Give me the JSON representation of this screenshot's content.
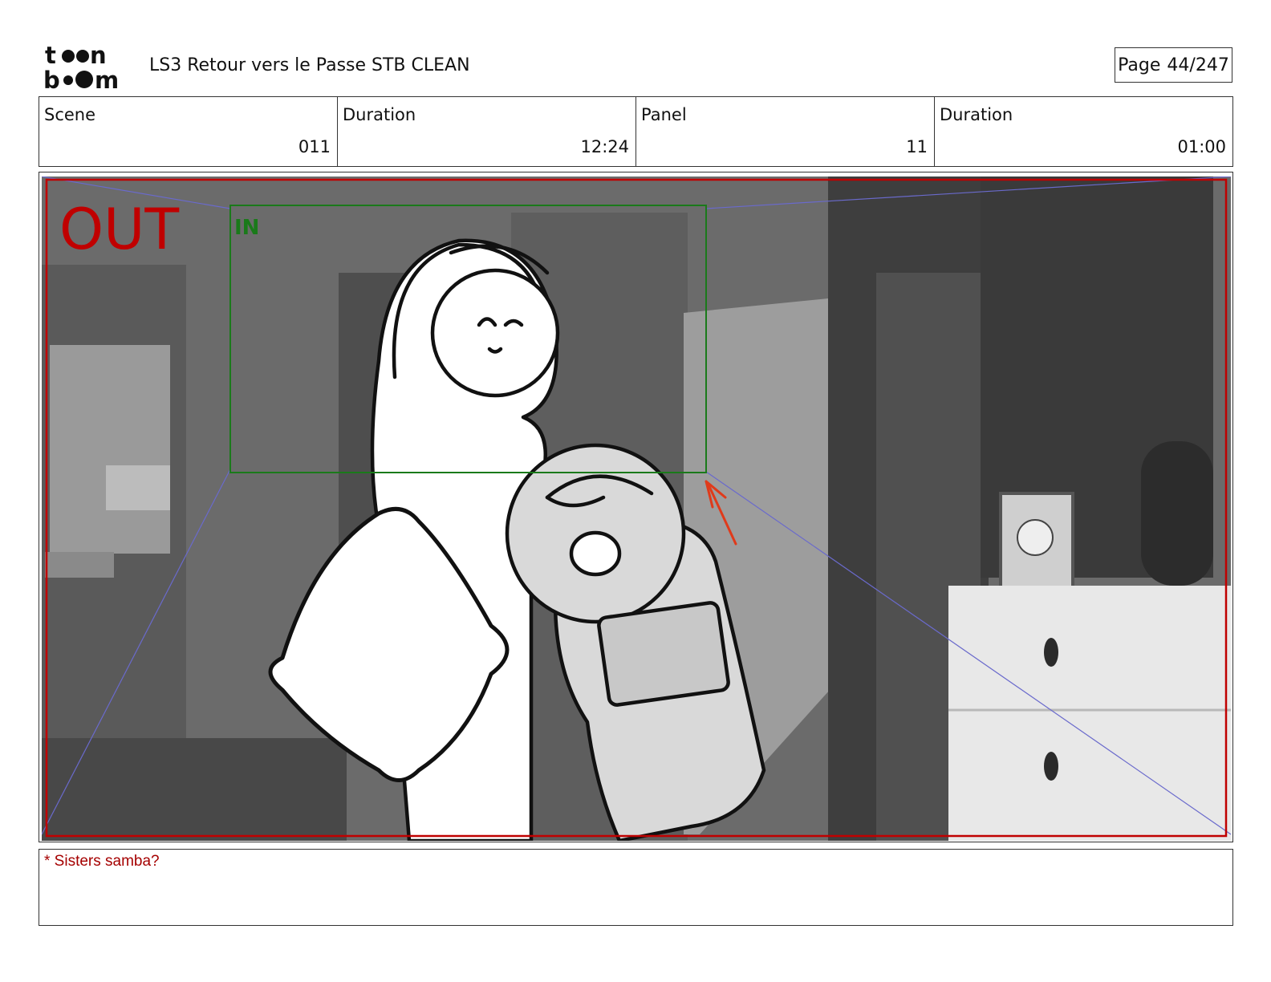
{
  "header": {
    "logo": {
      "line1": "toon",
      "line2": "boom"
    },
    "title": "LS3 Retour vers le Passe STB CLEAN",
    "page": {
      "label": "Page",
      "value": "44/247"
    }
  },
  "info": [
    {
      "label": "Scene",
      "value": "011"
    },
    {
      "label": "Duration",
      "value": "12:24"
    },
    {
      "label": "Panel",
      "value": "11"
    },
    {
      "label": "Duration",
      "value": "01:00"
    }
  ],
  "panel": {
    "out_label": "OUT",
    "in_label": "IN",
    "colors": {
      "out": "#c00000",
      "in": "#1a7a1a",
      "arrow": "#e03a1a",
      "guides": "#6a6acc"
    }
  },
  "notes": {
    "text": "* Sisters samba?"
  }
}
